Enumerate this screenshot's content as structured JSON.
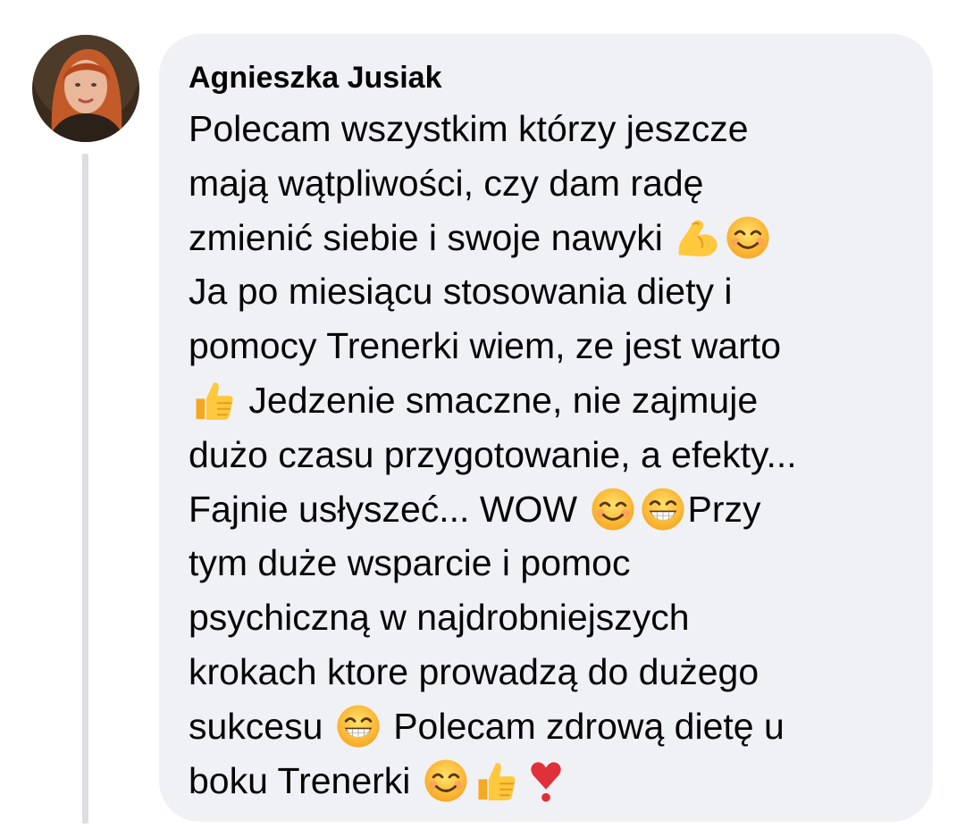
{
  "comment": {
    "author": "Agnieszka Jusiak",
    "lines": [
      [
        {
          "t": "text",
          "v": "Polecam wszystkim którzy jeszcze"
        }
      ],
      [
        {
          "t": "text",
          "v": "mają wątpliwości, czy dam radę"
        }
      ],
      [
        {
          "t": "text",
          "v": "zmienić siebie i swoje nawyki "
        },
        {
          "t": "emoji",
          "v": "flexed-biceps-emoji"
        },
        {
          "t": "emoji",
          "v": "smiling-face-emoji"
        }
      ],
      [
        {
          "t": "text",
          "v": "Ja po miesiącu stosowania diety i"
        }
      ],
      [
        {
          "t": "text",
          "v": "pomocy Trenerki wiem, ze jest warto"
        }
      ],
      [
        {
          "t": "emoji",
          "v": "thumbs-up-emoji"
        },
        {
          "t": "text",
          "v": " Jedzenie smaczne, nie zajmuje"
        }
      ],
      [
        {
          "t": "text",
          "v": "dużo czasu przygotowanie, a efekty..."
        }
      ],
      [
        {
          "t": "text",
          "v": "Fajnie usłyszeć... WOW "
        },
        {
          "t": "emoji",
          "v": "smiling-face-emoji"
        },
        {
          "t": "emoji",
          "v": "grinning-face-emoji"
        },
        {
          "t": "text",
          "v": "Przy"
        }
      ],
      [
        {
          "t": "text",
          "v": "tym duże wsparcie i pomoc"
        }
      ],
      [
        {
          "t": "text",
          "v": "psychiczną w najdrobniejszych"
        }
      ],
      [
        {
          "t": "text",
          "v": "krokach ktore prowadzą do dużego"
        }
      ],
      [
        {
          "t": "text",
          "v": "sukcesu "
        },
        {
          "t": "emoji",
          "v": "grinning-face-emoji"
        },
        {
          "t": "text",
          "v": " Polecam zdrową dietę u"
        }
      ],
      [
        {
          "t": "text",
          "v": "boku Trenerki "
        },
        {
          "t": "emoji",
          "v": "smiling-face-emoji"
        },
        {
          "t": "emoji",
          "v": "thumbs-up-emoji"
        },
        {
          "t": "emoji",
          "v": "heart-exclamation-emoji"
        }
      ]
    ]
  },
  "colors": {
    "bubble_background": "#f0f1f5",
    "text": "#050505",
    "thread_line": "#dcdee2"
  }
}
